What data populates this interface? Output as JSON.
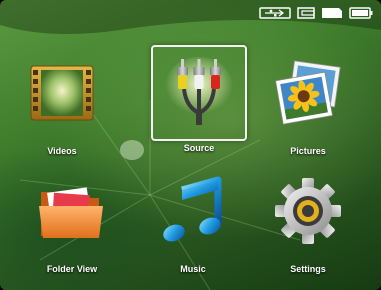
{
  "status_icons": [
    "usb-icon",
    "sd-card-icon",
    "internal-memory-icon",
    "battery-icon"
  ],
  "menu": {
    "items": [
      {
        "label": "Videos",
        "icon": "video-film-icon"
      },
      {
        "label": "Source",
        "icon": "av-cable-icon",
        "selected": true
      },
      {
        "label": "Pictures",
        "icon": "sunflower-photo-icon"
      },
      {
        "label": "Folder View",
        "icon": "folder-icon"
      },
      {
        "label": "Music",
        "icon": "music-note-icon"
      },
      {
        "label": "Settings",
        "icon": "gear-icon"
      }
    ]
  },
  "colors": {
    "background": "#3f7c2c",
    "label_text": "#ffffff",
    "selection_border": "#f2f2f2"
  }
}
